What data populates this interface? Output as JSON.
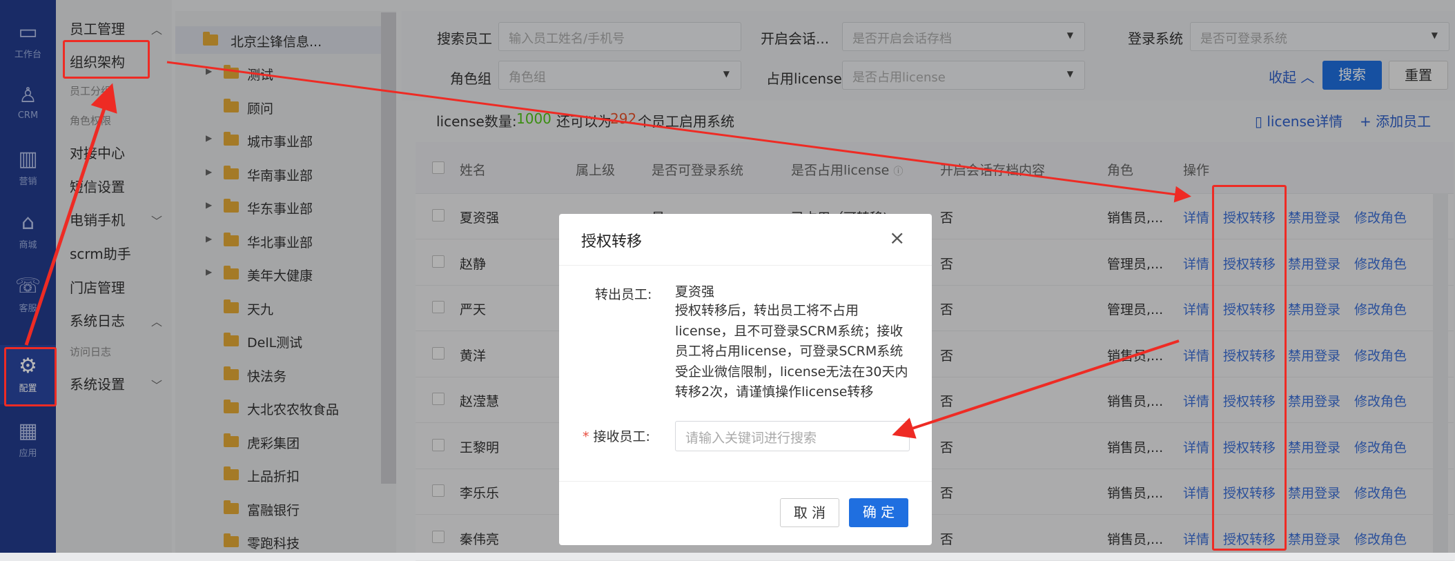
{
  "rail": {
    "items": [
      {
        "key": "workbench",
        "icon": "workbench-icon",
        "label": "工作台"
      },
      {
        "key": "crm",
        "icon": "person-icon",
        "label": "CRM"
      },
      {
        "key": "marketing",
        "icon": "chart-icon",
        "label": "营销"
      },
      {
        "key": "mall",
        "icon": "store-icon",
        "label": "商城"
      },
      {
        "key": "service",
        "icon": "headset-icon",
        "label": "客服"
      },
      {
        "key": "config",
        "icon": "gear-icon",
        "label": "配置"
      },
      {
        "key": "apps",
        "icon": "grid-icon",
        "label": "应用"
      }
    ]
  },
  "menu": {
    "employee_mgmt": "员工管理",
    "org": "组织架构",
    "employee_group": "员工分组",
    "role_perm": "角色权限",
    "dock_center": "对接中心",
    "sms": "短信设置",
    "tel_phone": "电销手机",
    "scrm": "scrm助手",
    "store": "门店管理",
    "syslog": "系统日志",
    "visit_log": "访问日志",
    "sys_settings": "系统设置"
  },
  "tree": {
    "root": "北京尘锋信息...",
    "nodes": [
      {
        "name": "测试",
        "expandable": true
      },
      {
        "name": "顾问",
        "expandable": false
      },
      {
        "name": "城市事业部",
        "expandable": true
      },
      {
        "name": "华南事业部",
        "expandable": true
      },
      {
        "name": "华东事业部",
        "expandable": true
      },
      {
        "name": "华北事业部",
        "expandable": true
      },
      {
        "name": "美年大健康",
        "expandable": true
      },
      {
        "name": "天九",
        "expandable": false
      },
      {
        "name": "DelL测试",
        "expandable": false
      },
      {
        "name": "快法务",
        "expandable": false
      },
      {
        "name": "大北农农牧食品",
        "expandable": false
      },
      {
        "name": "虎彩集团",
        "expandable": false
      },
      {
        "name": "上品折扣",
        "expandable": false
      },
      {
        "name": "富融银行",
        "expandable": false
      },
      {
        "name": "零跑科技",
        "expandable": false
      }
    ]
  },
  "filters": {
    "search_label": "搜索员工",
    "search_placeholder": "输入员工姓名/手机号",
    "archive_label": "开启会话...",
    "archive_placeholder": "是否开启会话存档",
    "login_label": "登录系统",
    "login_placeholder": "是否可登录系统",
    "role_label": "角色组",
    "role_placeholder": "角色组",
    "license_label": "占用license",
    "license_placeholder": "是否占用license",
    "collapse": "收起",
    "search_btn": "搜索",
    "reset_btn": "重置"
  },
  "license_bar": {
    "count_label": "license数量:",
    "count": "1000",
    "remain_prefix": "还可以为",
    "remain": "292",
    "remain_suffix": "个员工启用系统",
    "detail": "license详情",
    "add": "添加员工"
  },
  "table": {
    "headers": {
      "name": "姓名",
      "superior": "属上级",
      "can_login": "是否可登录系统",
      "uses_license": "是否占用license",
      "archive": "开启会话存档内容",
      "role": "角色",
      "ops": "操作"
    },
    "rows": [
      {
        "name": "夏资强",
        "can_login": "是",
        "uses_license": "已占用（可转移)",
        "archive": "否",
        "role": "销售员,..."
      },
      {
        "name": "赵静",
        "archive": "否",
        "role": "管理员,..."
      },
      {
        "name": "严天",
        "archive": "否",
        "role": "管理员,..."
      },
      {
        "name": "黄洋",
        "archive": "否",
        "role": "销售员,..."
      },
      {
        "name": "赵滢慧",
        "archive": "否",
        "role": "销售员,..."
      },
      {
        "name": "王黎明",
        "archive": "否",
        "role": "销售员,..."
      },
      {
        "name": "李乐乐",
        "archive": "否",
        "role": "销售员,..."
      },
      {
        "name": "秦伟亮",
        "archive": "否",
        "role": "销售员,..."
      }
    ],
    "ops": {
      "detail": "详情",
      "transfer": "授权转移",
      "disable": "禁用登录",
      "edit_role": "修改角色"
    }
  },
  "dialog": {
    "title": "授权转移",
    "from_label": "转出员工:",
    "from_name": "夏资强",
    "note_lines": [
      "授权转移后，转出员工将不占用",
      "license，且不可登录SCRM系统；接收",
      "员工将占用license，可登录SCRM系统",
      "受企业微信限制，license无法在30天内",
      "转移2次，请谨慎操作license转移"
    ],
    "to_label": "接收员工:",
    "to_placeholder": "请输入关键词进行搜索",
    "cancel": "取 消",
    "confirm": "确 定"
  },
  "colors": {
    "accent": "#1f6fe0",
    "rail": "#233c8e",
    "annotation": "#ee2b24",
    "license_count": "#52c41a"
  }
}
